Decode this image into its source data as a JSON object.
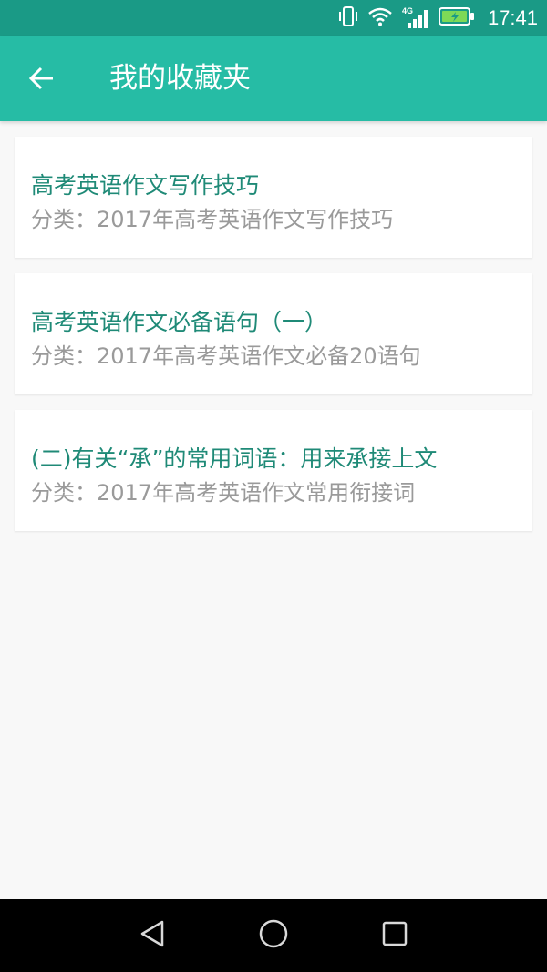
{
  "status_bar": {
    "time": "17:41",
    "network": "4G",
    "icons": [
      "vibrate-icon",
      "wifi-icon",
      "signal-icon",
      "battery-charging-icon"
    ]
  },
  "app_bar": {
    "back_icon": "arrow-left-icon",
    "title": "我的收藏夹"
  },
  "favorites": [
    {
      "title": "高考英语作文写作技巧",
      "category": "分类：2017年高考英语作文写作技巧"
    },
    {
      "title": "高考英语作文必备语句（一）",
      "category": "分类：2017年高考英语作文必备20语句"
    },
    {
      "title": "(二)有关“承”的常用词语：用来承接上文",
      "category": "分类：2017年高考英语作文常用衔接词"
    }
  ],
  "nav_bar": {
    "icons": [
      "back-triangle-icon",
      "home-circle-icon",
      "recents-square-icon"
    ]
  },
  "colors": {
    "status_bar": "#1a9a86",
    "app_bar": "#26bca5",
    "title_text": "#1f8a77",
    "category_text": "#9a9a9a"
  }
}
